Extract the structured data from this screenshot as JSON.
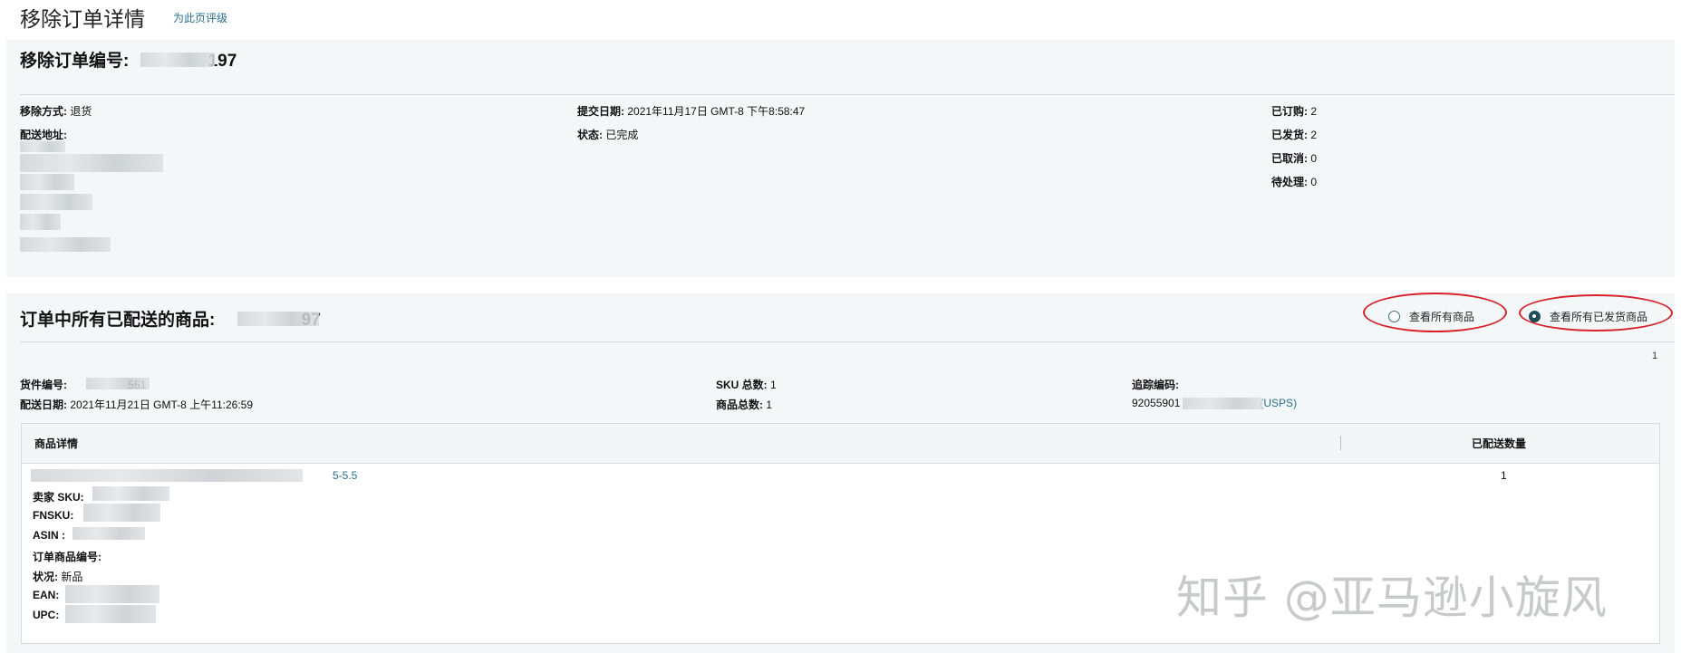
{
  "page": {
    "title": "移除订单详情",
    "rate_link": "为此页评级"
  },
  "order": {
    "heading_label": "移除订单编号:",
    "heading_suffix": "197",
    "removal_method_label": "移除方式:",
    "removal_method_value": "退货",
    "shipping_address_label": "配送地址:",
    "submit_date_label": "提交日期:",
    "submit_date_value": "2021年11月17日 GMT-8 下午8:58:47",
    "status_label": "状态:",
    "status_value": "已完成",
    "ordered_label": "已订购:",
    "ordered_value": "2",
    "shipped_label": "已发货:",
    "shipped_value": "2",
    "cancelled_label": "已取消:",
    "cancelled_value": "0",
    "pending_label": "待处理:",
    "pending_value": "0"
  },
  "shipped_items": {
    "heading_label": "订单中所有已配送的商品:",
    "heading_suffix": "97",
    "radio_all": "查看所有商品",
    "radio_shipped": "查看所有已发货商品",
    "selected": "radio_shipped",
    "page_number": "1",
    "shipment_no_label": "货件编号:",
    "shipment_no_suffix": "551",
    "ship_date_label": "配送日期:",
    "ship_date_value": "2021年11月21日 GMT-8 上午11:26:59",
    "sku_total_label": "SKU 总数:",
    "sku_total_value": "1",
    "units_total_label": "商品总数:",
    "units_total_value": "1",
    "tracking_label": "追踪编码:",
    "tracking_prefix": "92055901",
    "carrier": "(USPS)"
  },
  "table": {
    "col_details": "商品详情",
    "col_qty": "已配送数量",
    "rows": [
      {
        "title_suffix": "5-5.5",
        "seller_sku_label": "卖家 SKU:",
        "fnsku_label": "FNSKU:",
        "asin_label": "ASIN :",
        "order_item_label": "订单商品编号:",
        "condition_label": "状况:",
        "condition_value": "新品",
        "ean_label": "EAN:",
        "upc_label": "UPC:",
        "qty": "1"
      }
    ]
  },
  "watermark": "知乎 @亚马逊小旋风"
}
